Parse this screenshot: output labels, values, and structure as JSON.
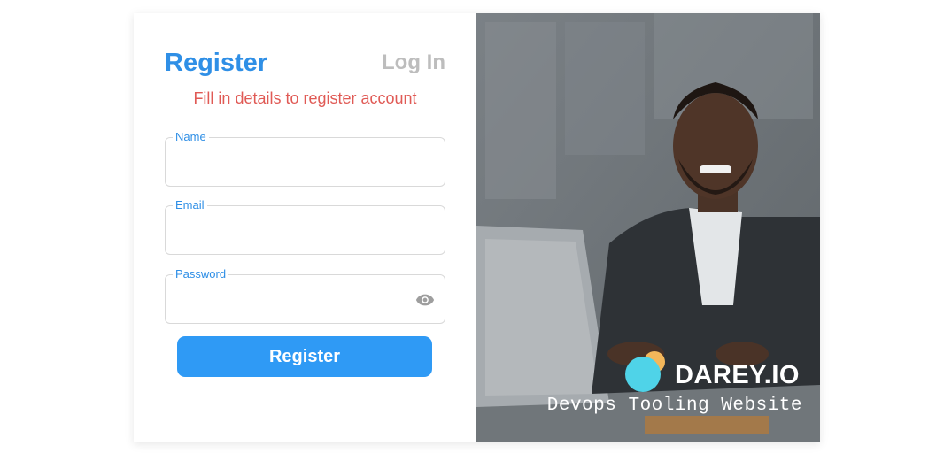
{
  "tabs": {
    "register": "Register",
    "login": "Log In"
  },
  "subtitle": "Fill in details to register account",
  "fields": {
    "name": {
      "label": "Name",
      "value": ""
    },
    "email": {
      "label": "Email",
      "value": ""
    },
    "password": {
      "label": "Password",
      "value": ""
    }
  },
  "submit_label": "Register",
  "brand": {
    "name": "DAREY.IO",
    "tagline": "Devops Tooling Website"
  },
  "colors": {
    "accent": "#2f8fe6",
    "button": "#2f9af5",
    "subtitle": "#e05a55",
    "inactive_tab": "#bdbdbd",
    "logo_orange": "#f4b75a",
    "logo_cyan": "#4fd3e8"
  },
  "icons": {
    "password_toggle": "eye-icon",
    "logo": "darey-logo-icon"
  }
}
